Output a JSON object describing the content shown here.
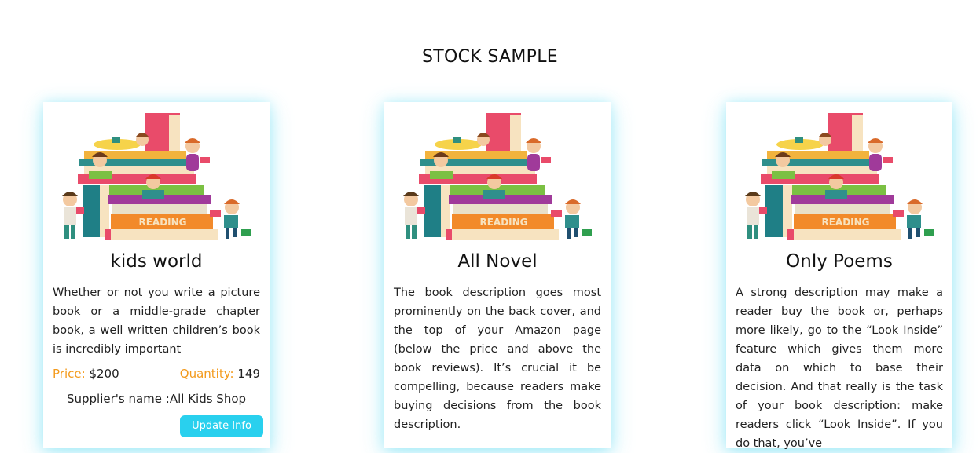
{
  "page": {
    "title": "STOCK SAMPLE"
  },
  "cards": [
    {
      "title": "kids world",
      "description": "Whether or not you write a picture book or a middle-grade chapter book, a well written children’s book is incredibly important",
      "price_label": "Price:",
      "price_value": "$200",
      "quantity_label": "Quantity:",
      "quantity_value": "149",
      "supplier": "Supplier's name :All Kids Shop",
      "button_label": "Update Info"
    },
    {
      "title": "All Novel",
      "description": "The book description goes most prominently on the back cover, and the top of your Amazon page (below the price and above the book reviews). It’s crucial it be compelling, because readers make buying decisions from the book description."
    },
    {
      "title": "Only Poems",
      "description": "A strong description may make a reader buy the book or, perhaps more likely, go to the “Look Inside” feature which gives them more data on which to base their decision. And that really is the task of your book description: make readers click “Look Inside”. If you do that, you’ve"
    }
  ],
  "image": {
    "sign_text": "READING"
  },
  "colors": {
    "accent_label": "#f39a1c",
    "button": "#29d0ee",
    "card_glow": "#50d7f0"
  }
}
